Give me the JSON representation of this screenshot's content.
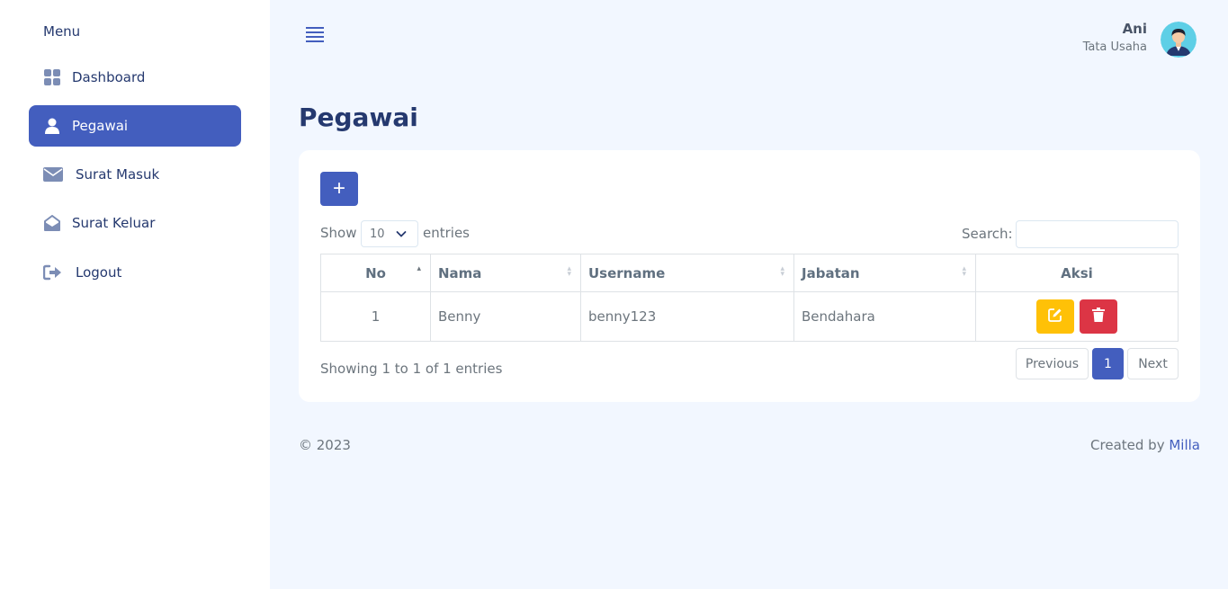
{
  "sidebar": {
    "title": "Menu",
    "items": [
      {
        "label": "Dashboard",
        "icon": "grid-icon"
      },
      {
        "label": "Pegawai",
        "icon": "person-icon"
      },
      {
        "label": "Surat Masuk",
        "icon": "envelope-icon"
      },
      {
        "label": "Surat Keluar",
        "icon": "envelope-open-icon"
      },
      {
        "label": "Logout",
        "icon": "logout-icon"
      }
    ]
  },
  "header": {
    "user_name": "Ani",
    "user_role": "Tata Usaha"
  },
  "page": {
    "title": "Pegawai"
  },
  "table_controls": {
    "add_label": "+",
    "show_label": "Show",
    "show_value": "10",
    "entries_label": "entries",
    "search_label": "Search:",
    "search_value": ""
  },
  "table": {
    "headers": [
      "No",
      "Nama",
      "Username",
      "Jabatan",
      "Aksi"
    ],
    "rows": [
      {
        "no": "1",
        "nama": "Benny",
        "username": "benny123",
        "jabatan": "Bendahara"
      }
    ]
  },
  "pagination": {
    "info": "Showing 1 to 1 of 1 entries",
    "previous": "Previous",
    "current": "1",
    "next": "Next"
  },
  "footer": {
    "copyright": "© 2023",
    "created_prefix": "Created by",
    "author": "Milla"
  },
  "colors": {
    "primary": "#435ebe",
    "edit": "#ffc107",
    "delete": "#dc3545",
    "background": "#f2f7ff"
  }
}
